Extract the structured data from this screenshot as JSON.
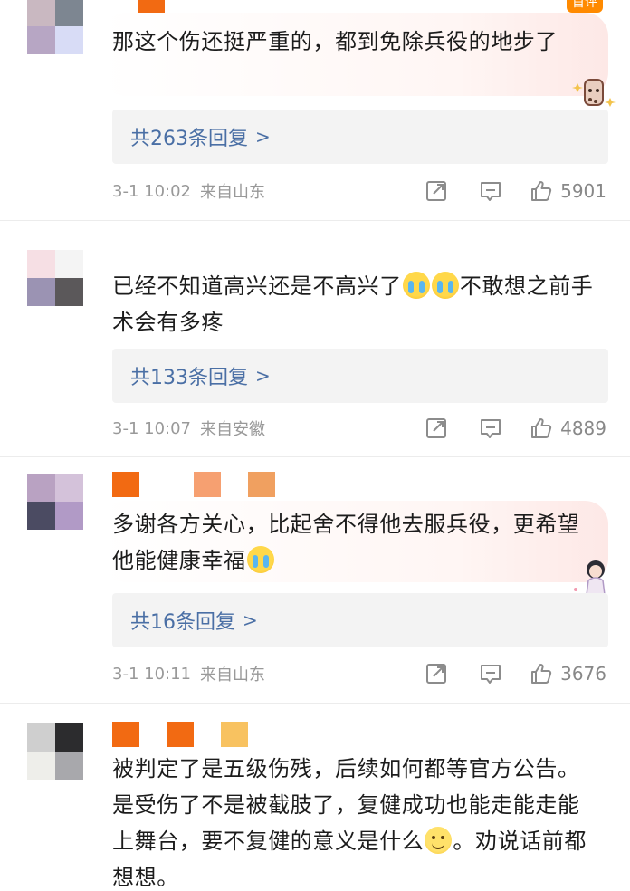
{
  "comments": [
    {
      "text": "那这个伤还挺严重的，都到免除兵役的地步了",
      "replies": "共263条回复",
      "time": "3-1 10:02",
      "source": "来自山东",
      "likes": "5901",
      "top_badge": "首评"
    },
    {
      "text_a": "已经不知道高兴还是不高兴了",
      "text_b": "不敢想之前手术会有多疼",
      "replies": "共133条回复",
      "time": "3-1 10:07",
      "source": "来自安徽",
      "likes": "4889"
    },
    {
      "text_a": "多谢各方关心，比起舍不得他去服兵役，更希望他能健康幸福",
      "replies": "共16条回复",
      "time": "3-1 10:11",
      "source": "来自山东",
      "likes": "3676"
    },
    {
      "text_a": "被判定了是五级伤残，后续如何都等官方公告。是受伤了不是被截肢了，复健成功也能走能走能上舞台，要不复健的意义是什么",
      "text_b": "。劝说话前都想想。"
    }
  ],
  "ui": {
    "reply_chevron": ">",
    "accent_link": "#4a6fa5",
    "icons": [
      "share-icon",
      "comment-icon",
      "like-icon"
    ]
  }
}
